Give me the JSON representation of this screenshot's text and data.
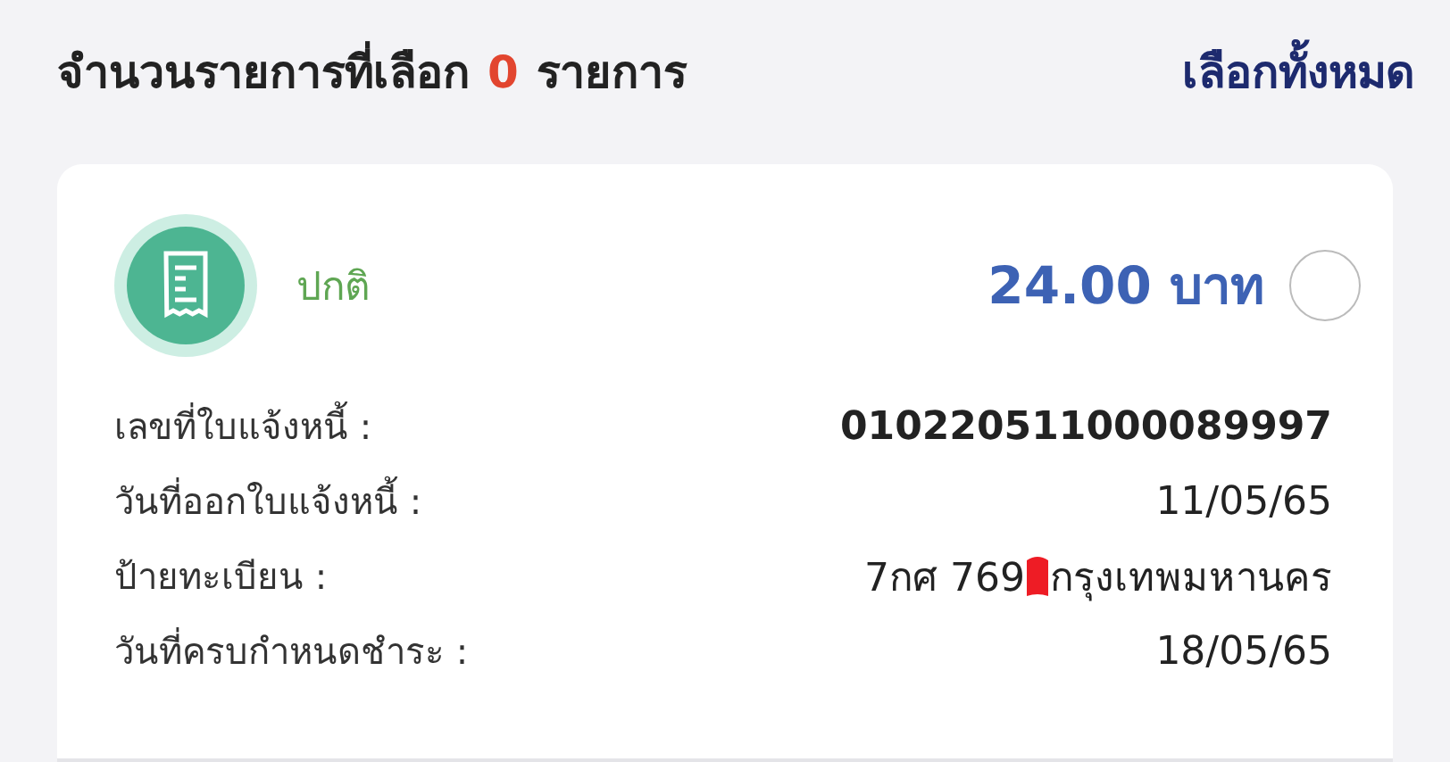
{
  "header": {
    "label": "จำนวนรายการที่เลือก",
    "count": "0",
    "unit": "รายการ",
    "select_all": "เลือกทั้งหมด"
  },
  "card": {
    "status": "ปกติ",
    "amount": "24.00 บาท",
    "selected": false,
    "fields": [
      {
        "kind": "text",
        "label": "เลขที่ใบแจ้งหนี้ :",
        "value": "010220511000089997",
        "bold": true
      },
      {
        "kind": "text",
        "label": "วันที่ออกใบแจ้งหนี้ :",
        "value": "11/05/65",
        "bold": false
      },
      {
        "kind": "redacted",
        "label": "ป้ายทะเบียน :",
        "value": "7กศ 769",
        "value_end": "กรุงเทพมหานคร",
        "bold": false
      },
      {
        "kind": "text",
        "label": "วันที่ครบกำหนดชำระ :",
        "value": "18/05/65",
        "bold": false
      }
    ]
  }
}
